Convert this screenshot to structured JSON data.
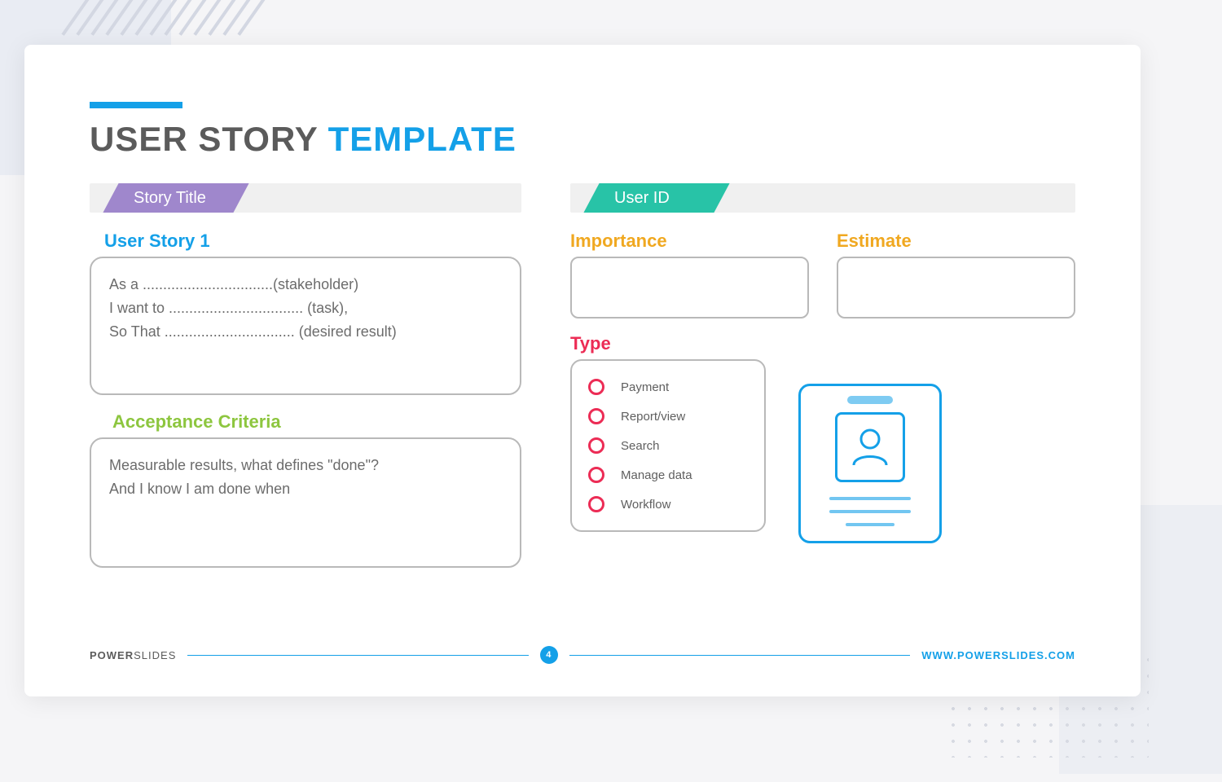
{
  "title": {
    "part1": "USER STORY",
    "part2": "TEMPLATE"
  },
  "left": {
    "tab": "Story Title",
    "story_heading": "User Story 1",
    "story_lines": [
      "As a ................................(stakeholder)",
      "I want to ................................. (task),",
      "So That ................................ (desired result)"
    ],
    "criteria_heading": "Acceptance Criteria",
    "criteria_lines": [
      "Measurable results, what defines \"done\"?",
      "And I know I am done  when"
    ]
  },
  "right": {
    "tab": "User ID",
    "importance_label": "Importance",
    "estimate_label": "Estimate",
    "type_label": "Type",
    "type_options": [
      "Payment",
      "Report/view",
      "Search",
      "Manage data",
      "Workflow"
    ]
  },
  "footer": {
    "brand_bold": "POWER",
    "brand_slim": "SLIDES",
    "page": "4",
    "url": "WWW.POWERSLIDES.COM"
  }
}
